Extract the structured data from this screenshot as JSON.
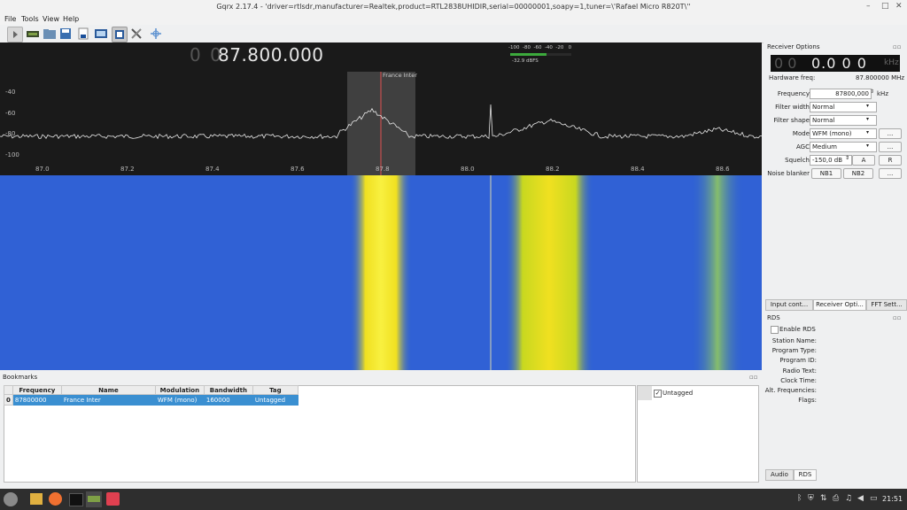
{
  "window": {
    "title": "Gqrx 2.17.4 - 'driver=rtlsdr,manufacturer=Realtek,product=RTL2838UHIDIR,serial=00000001,soapy=1,tuner=\\'Rafael Micro R820T\\''",
    "min_glyph": "–",
    "max_glyph": "□",
    "close_glyph": "✕"
  },
  "menu": {
    "file": "File",
    "tools": "Tools",
    "view": "View",
    "help": "Help"
  },
  "plot": {
    "freq_dim": "0 0",
    "freq_main": "87.800.000",
    "bookmark_label": "France Inter",
    "y_ticks": [
      "-40",
      "-60",
      "-80",
      "-100"
    ],
    "x_ticks": [
      "87.0",
      "87.2",
      "87.4",
      "87.6",
      "87.8",
      "88.0",
      "88.2",
      "88.4",
      "88.6"
    ],
    "smeter_scale": "-100  -80  -60  -40  -20   0",
    "smeter_value": "-32.9 dBFS"
  },
  "colors": {
    "waterfall_bg": "#2b5fd0",
    "signal": "#f0e020",
    "selection": "#3a8fd1"
  },
  "receiver": {
    "panel_title": "Receiver Options",
    "lcd_dim": "0 0",
    "lcd_main": "0.0 0 0",
    "lcd_unit": "kHz",
    "hw_freq_label": "Hardware freq:",
    "hw_freq_value": "87.800000 MHz",
    "frequency_label": "Frequency",
    "frequency_value": "87800,000",
    "frequency_unit": "kHz",
    "filter_width_label": "Filter width",
    "filter_width_value": "Normal",
    "filter_shape_label": "Filter shape",
    "filter_shape_value": "Normal",
    "mode_label": "Mode",
    "mode_value": "WFM (mono)",
    "agc_label": "AGC",
    "agc_value": "Medium",
    "squelch_label": "Squelch",
    "squelch_value": "-150,0 dB",
    "squelch_a": "A",
    "squelch_r": "R",
    "noise_label": "Noise blanker",
    "nb1": "NB1",
    "nb2": "NB2",
    "more": "...",
    "tabs": [
      "Input cont...",
      "Receiver Opti...",
      "FFT Sett..."
    ]
  },
  "rds": {
    "panel_title": "RDS",
    "enable_label": "Enable RDS",
    "fields": [
      "Station Name:",
      "Program Type:",
      "Program ID:",
      "Radio Text:",
      "Clock Time:",
      "Alt. Frequencies:",
      "Flags:"
    ],
    "tabs": [
      "Audio",
      "RDS"
    ]
  },
  "bookmarks": {
    "panel_title": "Bookmarks",
    "columns": [
      "Frequency",
      "Name",
      "Modulation",
      "Bandwidth",
      "Tag"
    ],
    "rows": [
      {
        "index": "0",
        "frequency": "87800000",
        "name": "France Inter",
        "modulation": "WFM (mono)",
        "bandwidth": "160000",
        "tag": "Untagged"
      }
    ],
    "tag_list": [
      "Untagged"
    ]
  },
  "taskbar": {
    "clock": "21:51"
  }
}
